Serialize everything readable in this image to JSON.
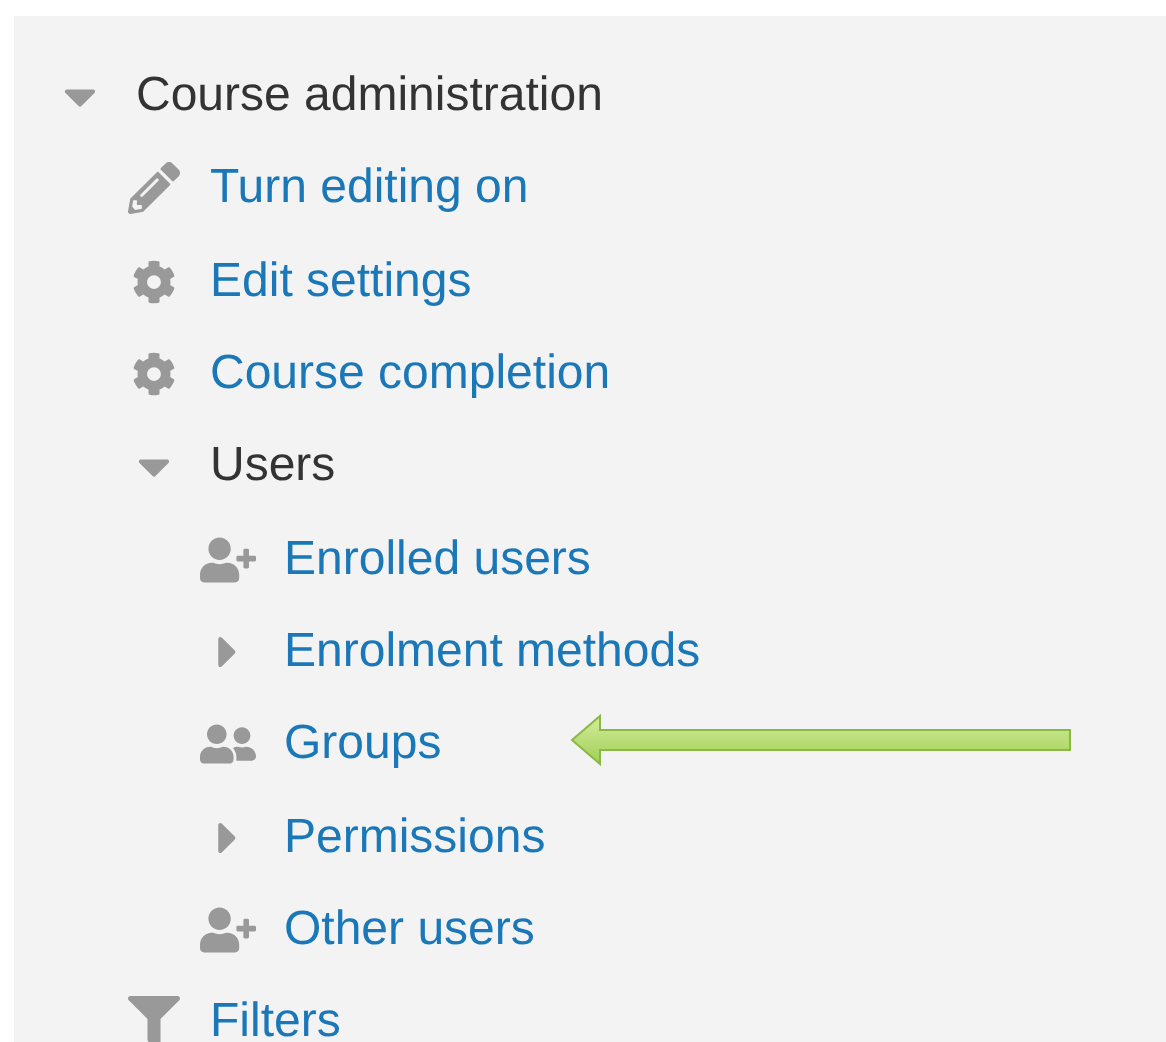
{
  "tree": [
    {
      "label": "Course administration",
      "kind": "category",
      "expanded": true,
      "children": [
        {
          "label": "Turn editing on",
          "kind": "pencil"
        },
        {
          "label": "Edit settings",
          "kind": "gear"
        },
        {
          "label": "Course completion",
          "kind": "gear"
        },
        {
          "label": "Users",
          "kind": "category",
          "expanded": true,
          "children": [
            {
              "label": "Enrolled users",
              "kind": "user-add"
            },
            {
              "label": "Enrolment methods",
              "kind": "node",
              "expanded": false
            },
            {
              "label": "Groups",
              "kind": "group"
            },
            {
              "label": "Permissions",
              "kind": "node",
              "expanded": false
            },
            {
              "label": "Other users",
              "kind": "user-add"
            }
          ]
        },
        {
          "label": "Filters",
          "kind": "filter"
        }
      ]
    }
  ]
}
